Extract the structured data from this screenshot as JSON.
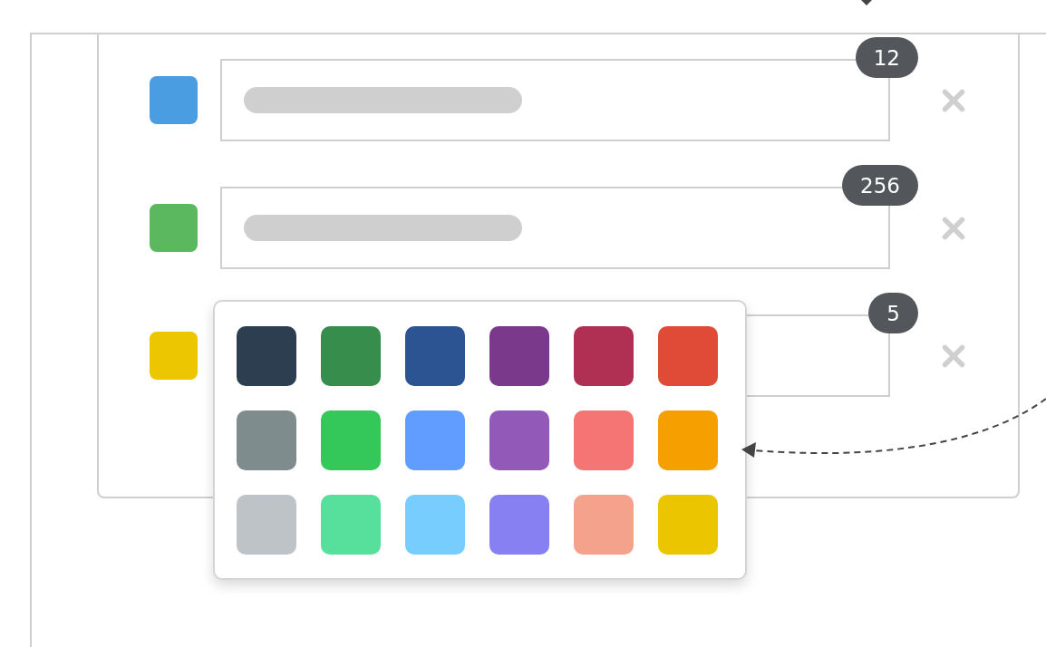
{
  "rows": [
    {
      "color": "#4a9de0",
      "count": "12"
    },
    {
      "color": "#5cb85f",
      "count": "256"
    },
    {
      "color": "#ecc600",
      "count": "5"
    }
  ],
  "palette": {
    "swatches": [
      {
        "color": "#2c3e50"
      },
      {
        "color": "#378d4c"
      },
      {
        "color": "#2c5392"
      },
      {
        "color": "#7a398b"
      },
      {
        "color": "#b03053"
      },
      {
        "color": "#e04b37"
      },
      {
        "color": "#7f8c8d"
      },
      {
        "color": "#34c759"
      },
      {
        "color": "#619cff"
      },
      {
        "color": "#9359b8"
      },
      {
        "color": "#f57574"
      },
      {
        "color": "#f69f00"
      },
      {
        "color": "#bdc3c7"
      },
      {
        "color": "#57e09c"
      },
      {
        "color": "#78cdff"
      },
      {
        "color": "#8680f2"
      },
      {
        "color": "#f4a28b"
      },
      {
        "color": "#ebc500"
      }
    ]
  }
}
